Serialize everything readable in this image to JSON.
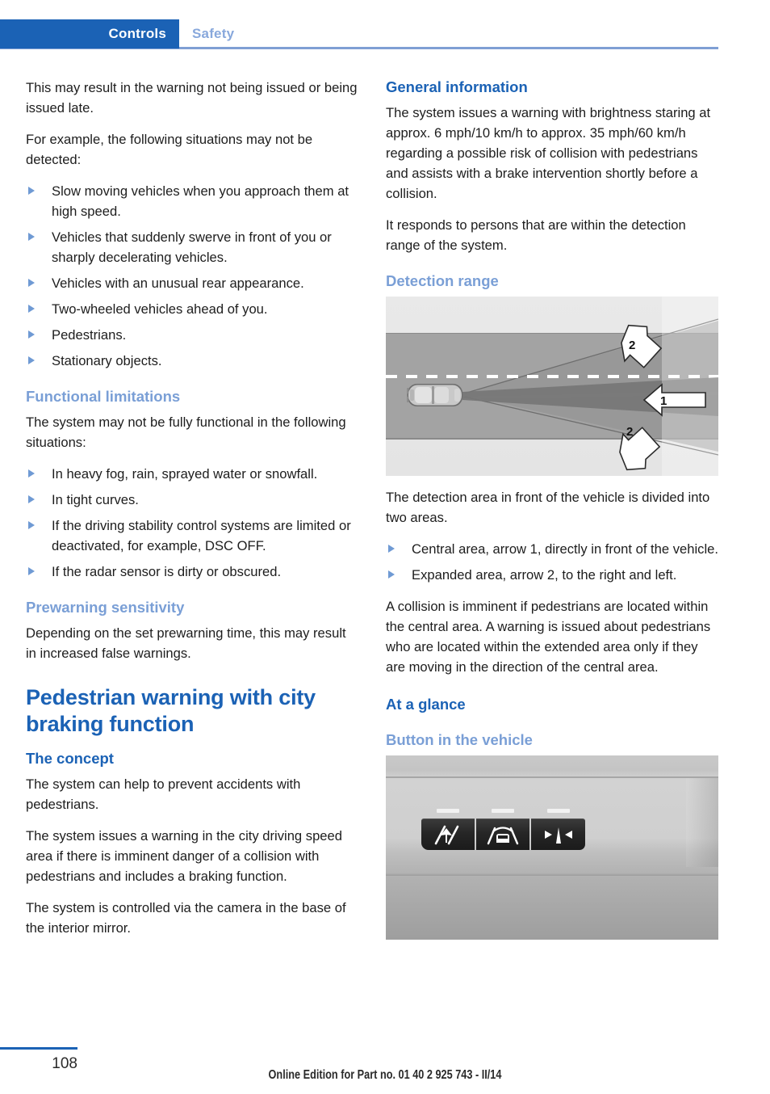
{
  "header": {
    "active_tab": "Controls",
    "inactive_tab": "Safety"
  },
  "colors": {
    "tab_blue": "#1b62b5",
    "heading_blue": "#1b62b5",
    "subheading_blue": "#7a9fd6",
    "rule_blue": "#7f9fd4",
    "bullet_blue": "#6f9ad4",
    "body_text": "#1d1d1d"
  },
  "left_column": {
    "para_1": "This may result in the warning not being issued or being issued late.",
    "para_2": "For example, the following situations may not be detected:",
    "bullets_not_detected": [
      "Slow moving vehicles when you approach them at high speed.",
      "Vehicles that suddenly swerve in front of you or sharply decelerating vehicles.",
      "Vehicles with an unusual rear appearance.",
      "Two-wheeled vehicles ahead of you.",
      "Pedestrians.",
      "Stationary objects."
    ],
    "functional_limitations": {
      "heading": "Functional limitations",
      "intro": "The system may not be fully functional in the following situations:",
      "bullets": [
        "In heavy fog, rain, sprayed water or snowfall.",
        "In tight curves.",
        "If the driving stability control systems are limited or deactivated, for example, DSC OFF.",
        "If the radar sensor is dirty or obscured."
      ]
    },
    "prewarning_sensitivity": {
      "heading": "Prewarning sensitivity",
      "para": "Depending on the set prewarning time, this may result in increased false warnings."
    },
    "chapter_title": "Pedestrian warning with city braking function",
    "the_concept": {
      "heading": "The concept",
      "para_1": "The system can help to prevent accidents with pedestrians.",
      "para_2": "The system issues a warning in the city driving speed area if there is imminent danger of a collision with pedestrians and includes a braking function.",
      "para_3": "The system is controlled via the camera in the base of the interior mirror."
    }
  },
  "right_column": {
    "general_information": {
      "heading": "General information",
      "para_1": "The system issues a warning with brightness staring at approx. 6 mph/10 km/h to approx. 35 mph/60 km/h regarding a possible risk of collision with pedestrians and assists with a brake intervention shortly before a collision.",
      "para_2": "It responds to persons that are within the detection range of the system."
    },
    "detection_range": {
      "heading": "Detection range",
      "figure": {
        "name": "detection-range-diagram",
        "arrow_1_label": "1",
        "arrow_2_top_label": "2",
        "arrow_2_bottom_label": "2"
      },
      "para_1": "The detection area in front of the vehicle is divided into two areas.",
      "bullets": [
        "Central area, arrow 1, directly in front of the vehicle.",
        "Expanded area, arrow 2, to the right and left."
      ],
      "para_2": "A collision is imminent if pedestrians are located within the central area. A warning is issued about pedestrians who are located within the extended area only if they are moving in the direction of the central area."
    },
    "at_a_glance": {
      "heading": "At a glance",
      "button_in_vehicle": {
        "heading": "Button in the vehicle",
        "figure_name": "vehicle-button-panel-photo",
        "buttons": [
          "lane-departure-warning-button",
          "collision-warning-button",
          "lane-change-warning-button"
        ]
      }
    }
  },
  "footer": {
    "page_number": "108",
    "edition_note": "Online Edition for Part no. 01 40 2 925 743 - II/14"
  }
}
